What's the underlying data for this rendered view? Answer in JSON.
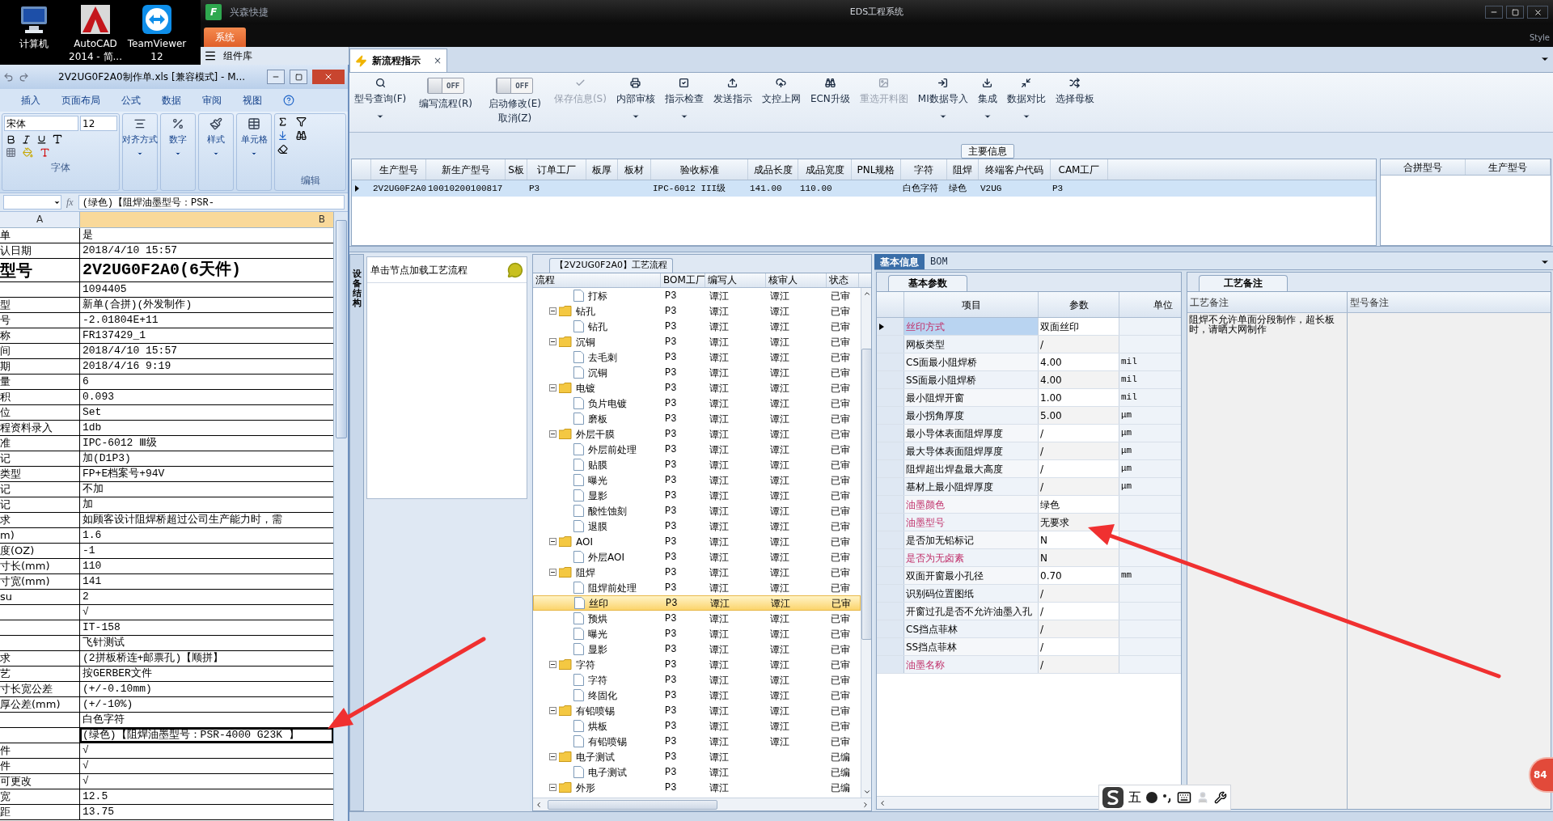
{
  "desktop": {
    "icons": [
      {
        "label": "计算机"
      },
      {
        "label": "AutoCAD 2014 - 简..."
      },
      {
        "label": "TeamViewer 12"
      }
    ]
  },
  "eds": {
    "logo_text": "F",
    "app_name": "兴森快捷",
    "title": "EDS工程系统",
    "style_label": "Style",
    "menu_tab": "系统",
    "side_header": "组件库",
    "doc_tab": {
      "label": "新流程指示",
      "close": "×"
    },
    "toolbar": [
      {
        "kind": "button",
        "label": "型号查询(F)",
        "menu": true,
        "disabled": false
      },
      {
        "kind": "toggle",
        "label": "编写流程(R)",
        "toggle_text": "OFF",
        "on": false
      },
      {
        "kind": "toggle",
        "label": "启动修改(E)",
        "sublabel": "取消(Z)",
        "toggle_text": "OFF",
        "on": false
      },
      {
        "kind": "button",
        "label": "保存信息(S)",
        "menu": false,
        "disabled": true
      },
      {
        "kind": "button",
        "label": "内部审核",
        "menu": true,
        "disabled": false
      },
      {
        "kind": "button",
        "label": "指示检查",
        "menu": true,
        "disabled": false
      },
      {
        "kind": "button",
        "label": "发送指示",
        "menu": false,
        "disabled": false
      },
      {
        "kind": "button",
        "label": "文控上网",
        "menu": false,
        "disabled": false
      },
      {
        "kind": "button",
        "label": "ECN升级",
        "menu": false,
        "disabled": false
      },
      {
        "kind": "button",
        "label": "重选开料图",
        "menu": false,
        "disabled": true
      },
      {
        "kind": "button",
        "label": "MI数据导入",
        "menu": true,
        "disabled": false
      },
      {
        "kind": "button",
        "label": "集成",
        "menu": true,
        "disabled": false
      },
      {
        "kind": "button",
        "label": "数据对比",
        "menu": true,
        "disabled": false
      },
      {
        "kind": "button",
        "label": "选择母板",
        "menu": false,
        "disabled": false
      }
    ],
    "section_label": "主要信息",
    "main_table": {
      "columns": [
        "生产型号",
        "新生产型号",
        "S板",
        "订单工厂",
        "板厚",
        "板材",
        "验收标准",
        "成品长度",
        "成品宽度",
        "PNL规格",
        "字符",
        "阻焊",
        "终端客户代码",
        "CAM工厂"
      ],
      "rows": [
        {
          "selected": true,
          "cells": [
            "2V2UG0F2A0",
            "10010200100817",
            "",
            "P3",
            "",
            "",
            "IPC-6012 III级",
            "141.00",
            "110.00",
            "",
            "白色字符",
            "绿色",
            "V2UG",
            "P3"
          ]
        }
      ]
    },
    "merge_table": {
      "columns": [
        "合拼型号",
        "生产型号"
      ]
    },
    "side_panel": {
      "tab": "设备结构",
      "hint": "单击节点加载工艺流程"
    },
    "process": {
      "title": "【2V2UG0F2A0】工艺流程",
      "columns": [
        "流程",
        "BOM工厂",
        "编写人",
        "核审人",
        "状态"
      ],
      "tree": [
        {
          "kind": "file",
          "label": "打标",
          "bom": "P3",
          "writer": "谭江",
          "reviewer": "谭江",
          "status": "已审",
          "selected": false
        },
        {
          "kind": "folder",
          "label": "钻孔",
          "bom": "P3",
          "writer": "谭江",
          "reviewer": "谭江",
          "status": "已审",
          "selected": false,
          "expanded": true,
          "children": [
            {
              "kind": "file",
              "label": "钻孔",
              "bom": "P3",
              "writer": "谭江",
              "reviewer": "谭江",
              "status": "已审",
              "selected": false
            }
          ]
        },
        {
          "kind": "folder",
          "label": "沉铜",
          "bom": "P3",
          "writer": "谭江",
          "reviewer": "谭江",
          "status": "已审",
          "selected": false,
          "expanded": true,
          "children": [
            {
              "kind": "file",
              "label": "去毛刺",
              "bom": "P3",
              "writer": "谭江",
              "reviewer": "谭江",
              "status": "已审",
              "selected": false
            },
            {
              "kind": "file",
              "label": "沉铜",
              "bom": "P3",
              "writer": "谭江",
              "reviewer": "谭江",
              "status": "已审",
              "selected": false
            }
          ]
        },
        {
          "kind": "folder",
          "label": "电镀",
          "bom": "P3",
          "writer": "谭江",
          "reviewer": "谭江",
          "status": "已审",
          "selected": false,
          "expanded": true,
          "children": [
            {
              "kind": "file",
              "label": "负片电镀",
              "bom": "P3",
              "writer": "谭江",
              "reviewer": "谭江",
              "status": "已审",
              "selected": false
            },
            {
              "kind": "file",
              "label": "磨板",
              "bom": "P3",
              "writer": "谭江",
              "reviewer": "谭江",
              "status": "已审",
              "selected": false
            }
          ]
        },
        {
          "kind": "folder",
          "label": "外层干膜",
          "bom": "P3",
          "writer": "谭江",
          "reviewer": "谭江",
          "status": "已审",
          "selected": false,
          "expanded": true,
          "children": [
            {
              "kind": "file",
              "label": "外层前处理",
              "bom": "P3",
              "writer": "谭江",
              "reviewer": "谭江",
              "status": "已审",
              "selected": false
            },
            {
              "kind": "file",
              "label": "贴膜",
              "bom": "P3",
              "writer": "谭江",
              "reviewer": "谭江",
              "status": "已审",
              "selected": false
            },
            {
              "kind": "file",
              "label": "曝光",
              "bom": "P3",
              "writer": "谭江",
              "reviewer": "谭江",
              "status": "已审",
              "selected": false
            },
            {
              "kind": "file",
              "label": "显影",
              "bom": "P3",
              "writer": "谭江",
              "reviewer": "谭江",
              "status": "已审",
              "selected": false
            },
            {
              "kind": "file",
              "label": "酸性蚀刻",
              "bom": "P3",
              "writer": "谭江",
              "reviewer": "谭江",
              "status": "已审",
              "selected": false
            },
            {
              "kind": "file",
              "label": "退膜",
              "bom": "P3",
              "writer": "谭江",
              "reviewer": "谭江",
              "status": "已审",
              "selected": false
            }
          ]
        },
        {
          "kind": "folder",
          "label": "AOI",
          "bom": "P3",
          "writer": "谭江",
          "reviewer": "谭江",
          "status": "已审",
          "selected": false,
          "expanded": true,
          "children": [
            {
              "kind": "file",
              "label": "外层AOI",
              "bom": "P3",
              "writer": "谭江",
              "reviewer": "谭江",
              "status": "已审",
              "selected": false
            }
          ]
        },
        {
          "kind": "folder",
          "label": "阻焊",
          "bom": "P3",
          "writer": "谭江",
          "reviewer": "谭江",
          "status": "已审",
          "selected": false,
          "expanded": true,
          "children": [
            {
              "kind": "file",
              "label": "阻焊前处理",
              "bom": "P3",
              "writer": "谭江",
              "reviewer": "谭江",
              "status": "已审",
              "selected": false
            },
            {
              "kind": "file",
              "label": "丝印",
              "bom": "P3",
              "writer": "谭江",
              "reviewer": "谭江",
              "status": "已审",
              "selected": true
            },
            {
              "kind": "file",
              "label": "预烘",
              "bom": "P3",
              "writer": "谭江",
              "reviewer": "谭江",
              "status": "已审",
              "selected": false
            },
            {
              "kind": "file",
              "label": "曝光",
              "bom": "P3",
              "writer": "谭江",
              "reviewer": "谭江",
              "status": "已审",
              "selected": false
            },
            {
              "kind": "file",
              "label": "显影",
              "bom": "P3",
              "writer": "谭江",
              "reviewer": "谭江",
              "status": "已审",
              "selected": false
            }
          ]
        },
        {
          "kind": "folder",
          "label": "字符",
          "bom": "P3",
          "writer": "谭江",
          "reviewer": "谭江",
          "status": "已审",
          "selected": false,
          "expanded": true,
          "children": [
            {
              "kind": "file",
              "label": "字符",
              "bom": "P3",
              "writer": "谭江",
              "reviewer": "谭江",
              "status": "已审",
              "selected": false
            },
            {
              "kind": "file",
              "label": "终固化",
              "bom": "P3",
              "writer": "谭江",
              "reviewer": "谭江",
              "status": "已审",
              "selected": false
            }
          ]
        },
        {
          "kind": "folder",
          "label": "有铅喷锡",
          "bom": "P3",
          "writer": "谭江",
          "reviewer": "谭江",
          "status": "已审",
          "selected": false,
          "expanded": true,
          "children": [
            {
              "kind": "file",
              "label": "烘板",
              "bom": "P3",
              "writer": "谭江",
              "reviewer": "谭江",
              "status": "已审",
              "selected": false
            },
            {
              "kind": "file",
              "label": "有铅喷锡",
              "bom": "P3",
              "writer": "谭江",
              "reviewer": "谭江",
              "status": "已审",
              "selected": false
            }
          ]
        },
        {
          "kind": "folder",
          "label": "电子测试",
          "bom": "P3",
          "writer": "谭江",
          "status": "已编",
          "selected": false,
          "expanded": true,
          "children": [
            {
              "kind": "file",
              "label": "电子测试",
              "bom": "P3",
              "writer": "谭江",
              "status": "已编",
              "selected": false
            }
          ]
        },
        {
          "kind": "folder",
          "label": "外形",
          "bom": "P3",
          "writer": "谭江",
          "status": "已编",
          "selected": false,
          "expanded": true
        }
      ]
    },
    "detail_tabs": [
      {
        "label": "基本信息",
        "selected": true
      },
      {
        "label": "BOM",
        "selected": false
      }
    ],
    "params": {
      "tab": "基本参数",
      "columns": [
        "项目",
        "参数",
        "单位"
      ],
      "rows": [
        {
          "item": "丝印方式",
          "value": "双面丝印",
          "highlighted": true,
          "selected": true
        },
        {
          "item": "网板类型",
          "value": "/",
          "highlighted": false,
          "selected": false
        },
        {
          "item": "CS面最小阻焊桥",
          "value": "4.00",
          "unit": "mil",
          "highlighted": false,
          "selected": false
        },
        {
          "item": "SS面最小阻焊桥",
          "value": "4.00",
          "unit": "mil",
          "highlighted": false,
          "selected": false
        },
        {
          "item": "最小阻焊开窗",
          "value": "1.00",
          "unit": "mil",
          "highlighted": false,
          "selected": false
        },
        {
          "item": "最小拐角厚度",
          "value": "5.00",
          "unit": "μm",
          "highlighted": false,
          "selected": false
        },
        {
          "item": "最小导体表面阻焊厚度",
          "value": "/",
          "unit": "μm",
          "highlighted": false,
          "selected": false
        },
        {
          "item": "最大导体表面阻焊厚度",
          "value": "/",
          "unit": "μm",
          "highlighted": false,
          "selected": false
        },
        {
          "item": "阻焊超出焊盘最大高度",
          "value": "/",
          "unit": "μm",
          "highlighted": false,
          "selected": false
        },
        {
          "item": "基材上最小阻焊厚度",
          "value": "/",
          "unit": "μm",
          "highlighted": false,
          "selected": false
        },
        {
          "item": "油墨颜色",
          "value": "绿色",
          "highlighted": true,
          "selected": false
        },
        {
          "item": "油墨型号",
          "value": "无要求",
          "highlighted": true,
          "selected": false
        },
        {
          "item": "是否加无铅标记",
          "value": "N",
          "highlighted": false,
          "selected": false
        },
        {
          "item": "是否为无卤素",
          "value": "N",
          "highlighted": true,
          "selected": false
        },
        {
          "item": "双面开窗最小孔径",
          "value": "0.70",
          "unit": "mm",
          "highlighted": false,
          "selected": false
        },
        {
          "item": "识别码位置图纸",
          "value": "/",
          "highlighted": false,
          "selected": false
        },
        {
          "item": "开窗过孔是否不允许油墨入孔",
          "value": "/",
          "highlighted": false,
          "selected": false
        },
        {
          "item": "CS挡点菲林",
          "value": "/",
          "highlighted": false,
          "selected": false
        },
        {
          "item": "SS挡点菲林",
          "value": "/",
          "highlighted": false,
          "selected": false
        },
        {
          "item": "油墨名称",
          "value": "/",
          "highlighted": true,
          "selected": false
        }
      ]
    },
    "notes": {
      "tab": "工艺备注",
      "columns": [
        "工艺备注",
        "型号备注"
      ],
      "process_note": "阻焊不允许单面分段制作，超长板时，请晒大网制作"
    }
  },
  "excel": {
    "title": "2V2UG0F2A0制作单.xls  [兼容模式] - M...",
    "ribbon_tabs": [
      "插入",
      "页面布局",
      "公式",
      "数据",
      "审阅",
      "视图"
    ],
    "font_name": "宋体",
    "font_size": "12",
    "font_group": "字体",
    "ribbon_buttons": [
      "对齐方式",
      "数字",
      "样式",
      "单元格"
    ],
    "edit_group": "编辑",
    "function_label": "fx",
    "formula": "(绿色)【阻焊油墨型号：PSR-",
    "columns": [
      "A",
      "B"
    ],
    "rows": [
      {
        "kind": "text",
        "a": "单",
        "b": "是",
        "selected": false
      },
      {
        "kind": "text",
        "a": "认日期",
        "b": "2018/4/10 15:57",
        "selected": false
      },
      {
        "kind": "heading",
        "a": "型号",
        "b": "2V2UG0F2A0(6天件)",
        "selected": false
      },
      {
        "kind": "text",
        "b": "1094405",
        "selected": false
      },
      {
        "kind": "text",
        "a": "型",
        "b": "新单(合拼)(外发制作)",
        "selected": false
      },
      {
        "kind": "text",
        "a": "号",
        "b": "-2.01804E+11",
        "selected": false
      },
      {
        "kind": "text",
        "a": "称",
        "b": "FR137429_1",
        "selected": false
      },
      {
        "kind": "text",
        "a": "间",
        "b": "2018/4/10 15:57",
        "selected": false
      },
      {
        "kind": "text",
        "a": "期",
        "b": "2018/4/16 9:19",
        "selected": false
      },
      {
        "kind": "text",
        "a": "量",
        "b": "6",
        "selected": false
      },
      {
        "kind": "text",
        "a": "积",
        "b": "0.093",
        "selected": false
      },
      {
        "kind": "text",
        "a": "位",
        "b": "Set",
        "selected": false
      },
      {
        "kind": "text",
        "a": "程资料录入",
        "b": "1db",
        "selected": false
      },
      {
        "kind": "text",
        "a": "准",
        "b": "IPC-6012 Ⅲ级",
        "selected": false
      },
      {
        "kind": "text",
        "a": "记",
        "b": "加(D1P3)",
        "selected": false
      },
      {
        "kind": "text",
        "a": "类型",
        "b": "FP+E档案号+94V",
        "selected": false
      },
      {
        "kind": "text",
        "a": "记",
        "b": "不加",
        "selected": false
      },
      {
        "kind": "text",
        "a": "记",
        "b": "加",
        "selected": false
      },
      {
        "kind": "text",
        "a": "求",
        "b": "如顾客设计阻焊桥超过公司生产能力时，需",
        "selected": false
      },
      {
        "kind": "text",
        "a": "m)",
        "b": "1.6",
        "selected": false
      },
      {
        "kind": "text",
        "a": "度(OZ)",
        "b": "-1",
        "selected": false
      },
      {
        "kind": "text",
        "a": "寸长(mm)",
        "b": "110",
        "selected": false
      },
      {
        "kind": "text",
        "a": "寸宽(mm)",
        "b": "141",
        "selected": false
      },
      {
        "kind": "text",
        "a": "su",
        "b": "2",
        "selected": false
      },
      {
        "kind": "text",
        "b": "√",
        "selected": false
      },
      {
        "kind": "text",
        "b": "IT-158",
        "selected": false
      },
      {
        "kind": "text",
        "b": "飞针测试",
        "selected": false
      },
      {
        "kind": "text",
        "a": "求",
        "b": "(2拼板桥连+邮票孔)【顺拼】",
        "selected": false
      },
      {
        "kind": "text",
        "a": "艺",
        "b": "按GERBER文件",
        "selected": false
      },
      {
        "kind": "text",
        "a": "寸长宽公差",
        "b": "(+/-0.10mm)",
        "selected": false
      },
      {
        "kind": "text",
        "a": "厚公差(mm)",
        "b": "(+/-10%)",
        "selected": false
      },
      {
        "kind": "text",
        "b": "白色字符",
        "selected": false
      },
      {
        "kind": "text",
        "b": "(绿色)【阻焊油墨型号：PSR-4000 G23K 】",
        "selected": true
      },
      {
        "kind": "text",
        "a": "件",
        "b": "√",
        "selected": false
      },
      {
        "kind": "text",
        "a": "件",
        "b": "√",
        "selected": false
      },
      {
        "kind": "text",
        "a": "可更改",
        "b": "√",
        "selected": false
      },
      {
        "kind": "text",
        "a": "宽",
        "b": "12.5",
        "selected": false
      },
      {
        "kind": "text",
        "a": "距",
        "b": "13.75",
        "selected": false
      }
    ]
  },
  "ime": {
    "label": "五"
  },
  "badge": "84"
}
